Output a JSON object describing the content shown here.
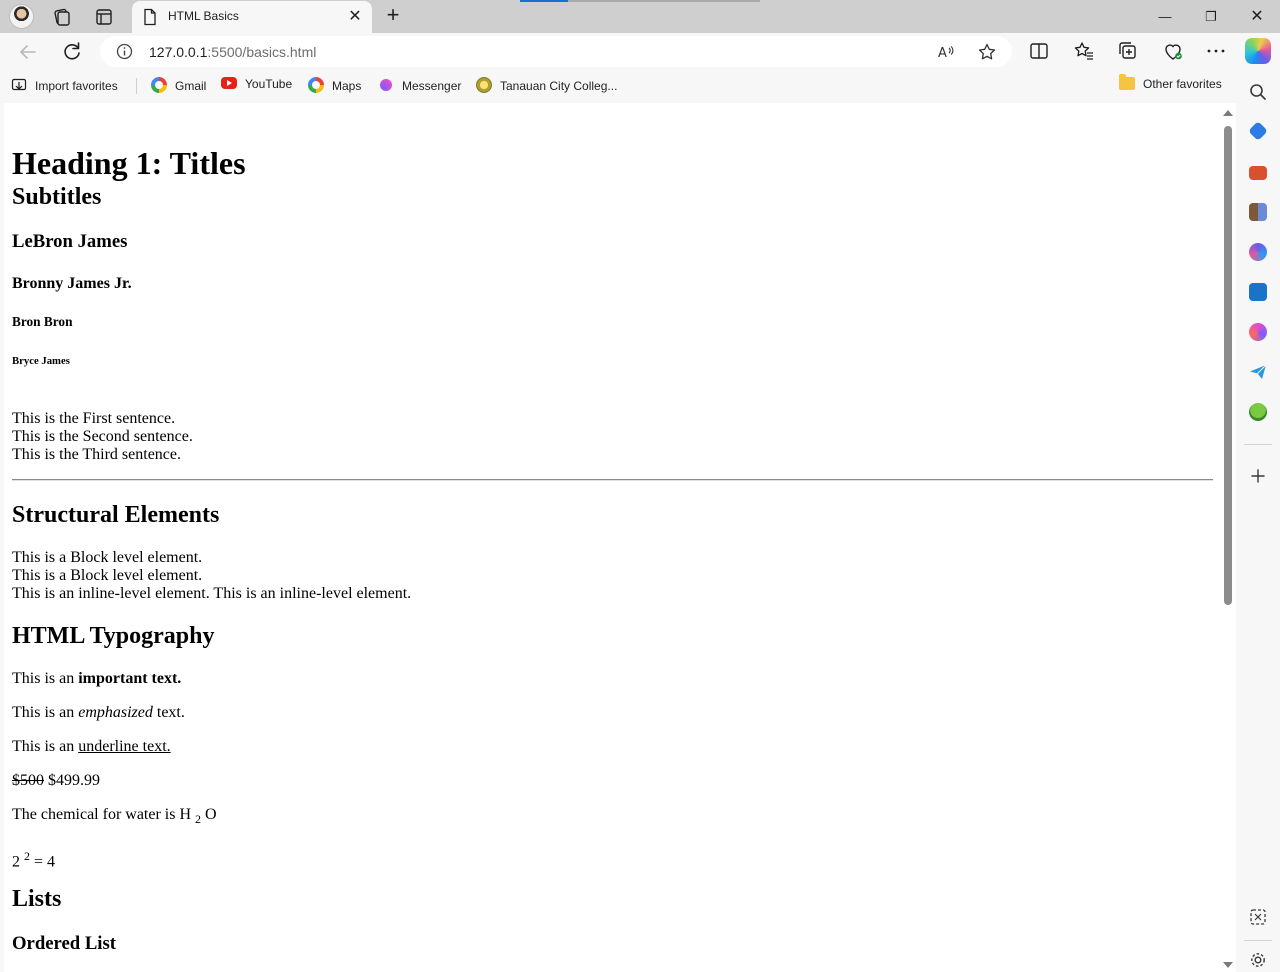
{
  "browser": {
    "tab": {
      "title": "HTML Basics",
      "close_glyph": "✕"
    },
    "new_tab_glyph": "+",
    "window_controls": {
      "minimize": "—",
      "restore": "❐",
      "close": "✕"
    },
    "address": {
      "host": "127.0.0.1",
      "rest": ":5500/basics.html"
    },
    "favorites": [
      {
        "label": "Import favorites",
        "icon": "import-icon"
      },
      {
        "label": "Gmail",
        "icon": "google-icon"
      },
      {
        "label": "YouTube",
        "icon": "youtube-icon"
      },
      {
        "label": "Maps",
        "icon": "google-icon"
      },
      {
        "label": "Messenger",
        "icon": "messenger-icon"
      },
      {
        "label": "Tanauan City Colleg...",
        "icon": "college-icon"
      }
    ],
    "other_favorites": "Other favorites"
  },
  "page": {
    "h1": "Heading 1: Titles",
    "h2": "Subtitles",
    "h3": "LeBron James",
    "h4": "Bronny James Jr.",
    "h5": "Bron Bron",
    "h6": "Bryce James",
    "sentences": [
      "This is the First sentence.",
      "This is the Second sentence.",
      "This is the Third sentence."
    ],
    "structural_heading": "Structural Elements",
    "block_lines": [
      "This is a Block level element.",
      "This is a Block level element."
    ],
    "inline_line": "This is an inline-level element. This is an inline-level element.",
    "typography_heading": "HTML Typography",
    "strong": {
      "prefix": "This is an ",
      "bold": "important text."
    },
    "em": {
      "prefix": "This is an ",
      "italic": "emphasized",
      "suffix": " text."
    },
    "underline": {
      "prefix": "This is an ",
      "underlined": "underline text."
    },
    "price": {
      "old": "$500",
      "new": " $499.99"
    },
    "chemical": {
      "prefix": "The chemical for water is H ",
      "sub": "2",
      "suffix": " O"
    },
    "power": {
      "base": "2 ",
      "sup": "2",
      "suffix": " = 4"
    },
    "lists_heading": "Lists",
    "ordered_list_heading": "Ordered List"
  }
}
